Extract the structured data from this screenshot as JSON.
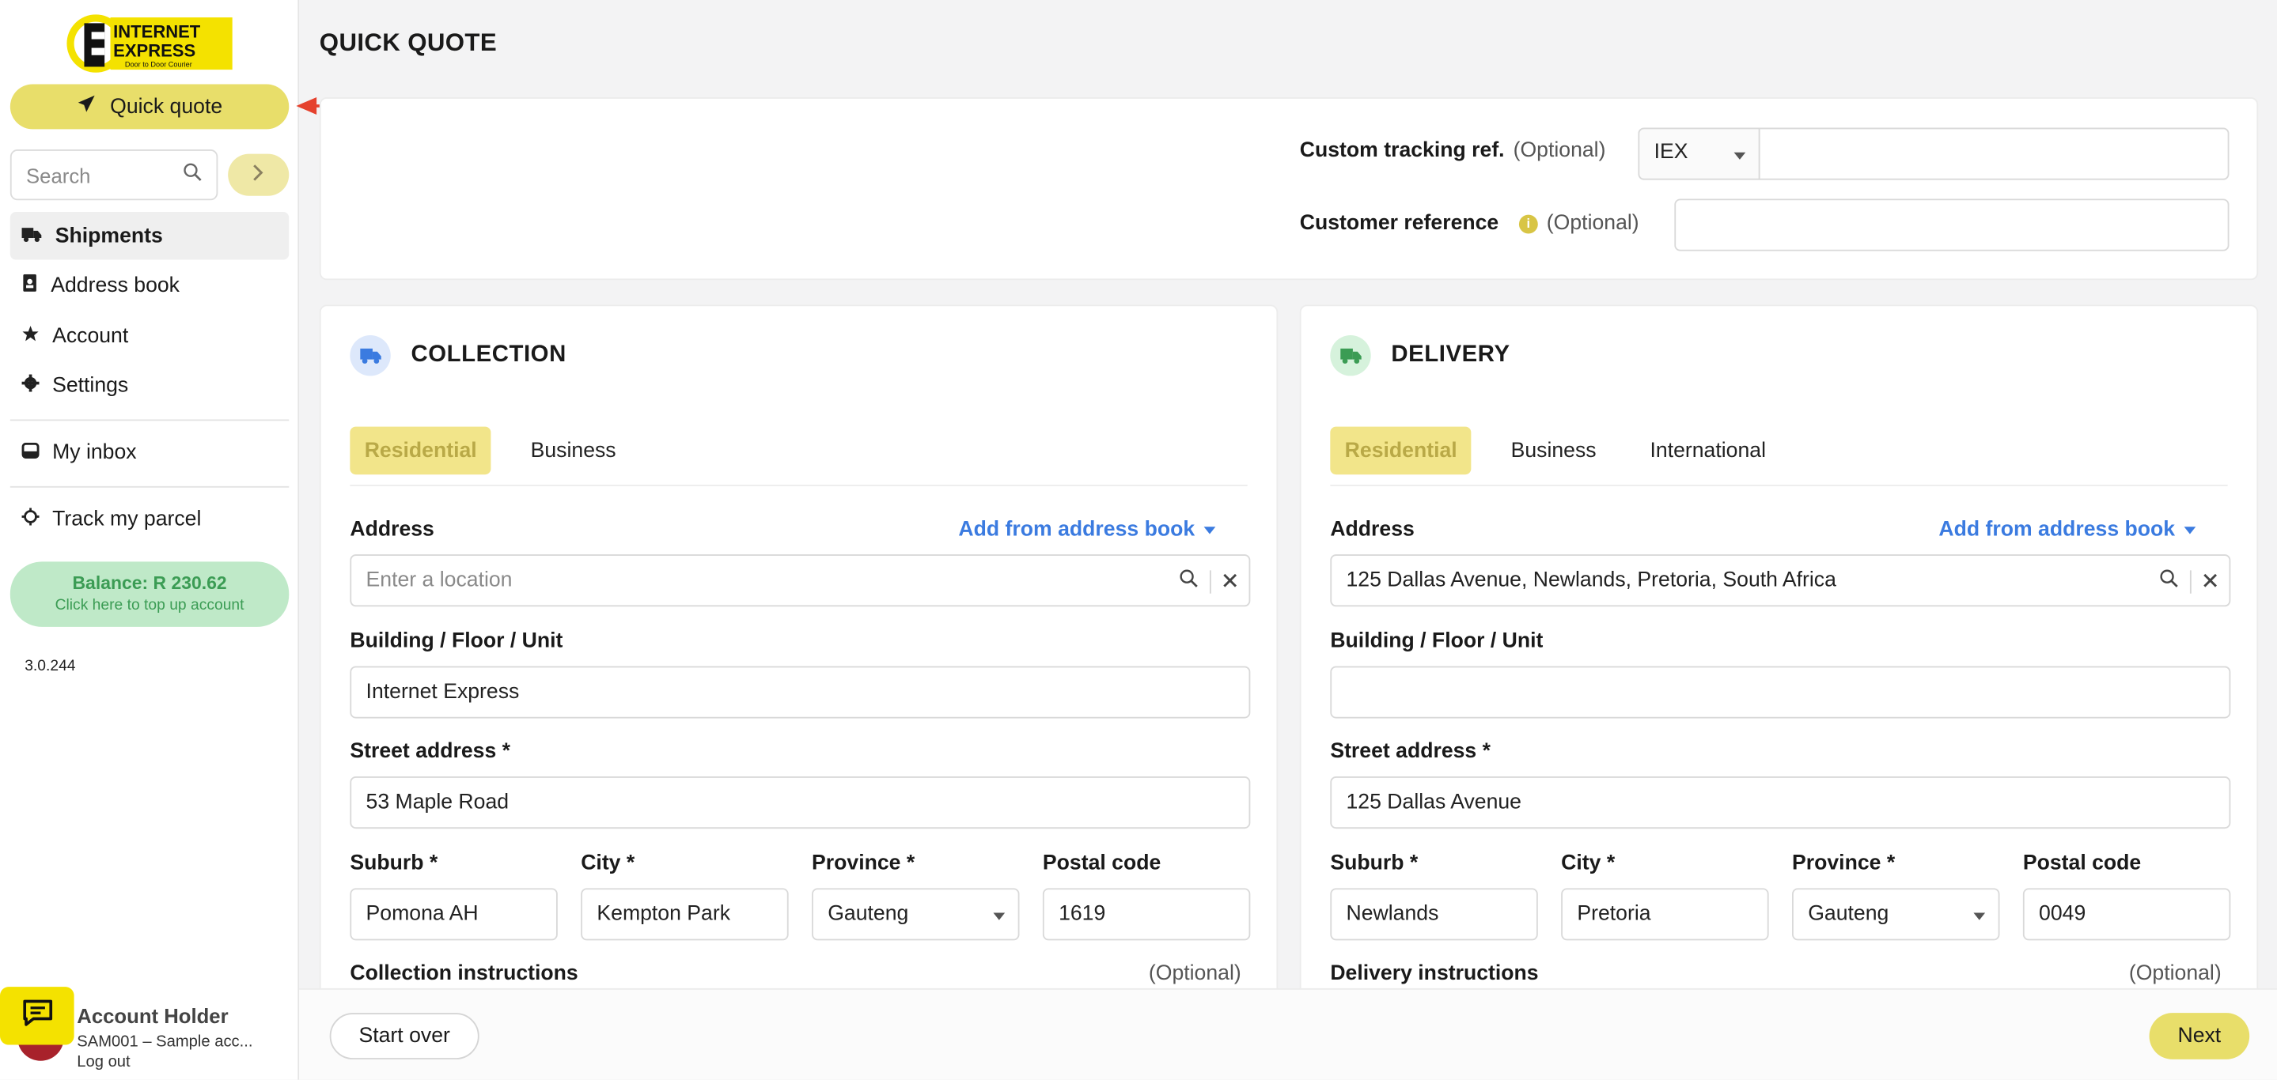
{
  "sidebar": {
    "logo_text": "INTERNET EXPRESS",
    "logo_tagline": "Door to Door Courier",
    "quick_quote_label": "Quick quote",
    "search_placeholder": "Search",
    "nav": [
      {
        "label": "Shipments",
        "icon": "truck-icon"
      },
      {
        "label": "Address book",
        "icon": "address-book-icon"
      },
      {
        "label": "Account",
        "icon": "star-icon"
      },
      {
        "label": "Settings",
        "icon": "gear-icon"
      },
      {
        "label": "My inbox",
        "icon": "inbox-icon"
      },
      {
        "label": "Track my parcel",
        "icon": "crosshair-icon"
      }
    ],
    "balance_text": "Balance: R 230.62",
    "balance_sub": "Click here to top up account",
    "version": "3.0.244",
    "account_name": "Account Holder",
    "account_sub": "SAM001 – Sample acc...",
    "logout_label": "Log out"
  },
  "page": {
    "title": "QUICK QUOTE"
  },
  "refs": {
    "custom_tracking_label": "Custom tracking ref.",
    "custom_tracking_optional": "(Optional)",
    "prefix_value": "IEX",
    "custom_tracking_value": "",
    "customer_reference_label": "Customer reference",
    "customer_reference_optional": "(Optional)",
    "customer_reference_value": ""
  },
  "collection": {
    "title": "COLLECTION",
    "tabs": [
      "Residential",
      "Business"
    ],
    "address_label": "Address",
    "add_from_book": "Add from address book",
    "address_placeholder": "Enter a location",
    "address_value": "",
    "building_label": "Building / Floor / Unit",
    "building_value": "Internet Express",
    "street_label": "Street address *",
    "street_value": "53 Maple Road",
    "suburb_label": "Suburb *",
    "suburb_value": "Pomona AH",
    "city_label": "City *",
    "city_value": "Kempton Park",
    "province_label": "Province *",
    "province_value": "Gauteng",
    "postal_label": "Postal code",
    "postal_value": "1619",
    "instructions_label": "Collection instructions",
    "instructions_optional": "(Optional)"
  },
  "delivery": {
    "title": "DELIVERY",
    "tabs": [
      "Residential",
      "Business",
      "International"
    ],
    "address_label": "Address",
    "add_from_book": "Add from address book",
    "address_value": "125 Dallas Avenue, Newlands, Pretoria, South Africa",
    "building_label": "Building / Floor / Unit",
    "building_value": "",
    "street_label": "Street address *",
    "street_value": "125 Dallas Avenue",
    "suburb_label": "Suburb *",
    "suburb_value": "Newlands",
    "city_label": "City *",
    "city_value": "Pretoria",
    "province_label": "Province *",
    "province_value": "Gauteng",
    "postal_label": "Postal code",
    "postal_value": "0049",
    "instructions_label": "Delivery instructions",
    "instructions_optional": "(Optional)"
  },
  "footer": {
    "start_over_label": "Start over",
    "next_label": "Next"
  },
  "colors": {
    "accent_yellow": "#e8de6a",
    "link_blue": "#3b7be0",
    "balance_green": "#3b9c54",
    "arrow_red": "#e5412d"
  }
}
